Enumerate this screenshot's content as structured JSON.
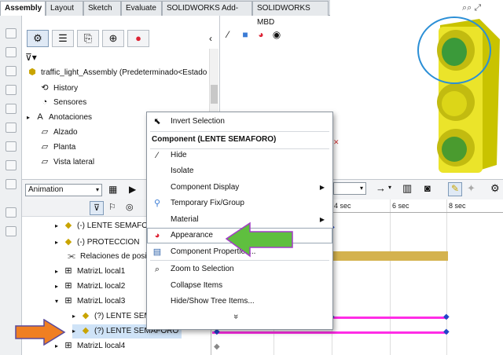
{
  "tabs": [
    "Assembly",
    "Layout",
    "Sketch",
    "Evaluate",
    "SOLIDWORKS Add-Ins",
    "SOLIDWORKS MBD"
  ],
  "active_tab": "Assembly",
  "feature_tree": {
    "root": "traffic_light_Assembly  (Predeterminado<Estado",
    "items": [
      "History",
      "Sensores",
      "Anotaciones",
      "Alzado",
      "Planta",
      "Vista lateral"
    ]
  },
  "motion": {
    "study_type": "Animation",
    "timeline_labels": [
      "4 sec",
      "6 sec",
      "8 sec"
    ],
    "tree": [
      "(-) LENTE SEMAFO",
      "(-) PROTECCION",
      "Relaciones de posi",
      "MatrizL local1",
      "MatrizL local2",
      "MatrizL local3",
      "(?) LENTE SEM",
      "(?) LENTE SEMAFORO",
      "MatrizL local4"
    ]
  },
  "context_menu": {
    "items": [
      {
        "label": "Invert Selection",
        "icon": "cursor-icon"
      },
      {
        "label": "Component (LENTE SEMAFORO)",
        "header": true
      },
      {
        "label": "Hide",
        "icon": "hide-icon"
      },
      {
        "label": "Isolate"
      },
      {
        "label": "Component Display",
        "submenu": true
      },
      {
        "label": "Temporary Fix/Group",
        "icon": "fix-icon"
      },
      {
        "label": "Material",
        "submenu": true
      },
      {
        "label": "Appearance",
        "icon": "appearance-icon",
        "highlighted": true
      },
      {
        "label": "Component Properties...",
        "icon": "properties-icon"
      },
      {
        "label": "Zoom to Selection",
        "icon": "zoom-icon"
      },
      {
        "label": "Collapse Items"
      },
      {
        "label": "Hide/Show Tree Items..."
      }
    ],
    "more": "»"
  },
  "colors": {
    "accent_green": "#5fbf3f",
    "accent_orange": "#f07f22",
    "key_magenta": "#ff2de6",
    "bar_tan": "#d4b24e",
    "traffic_yellow": "#f2ec2c"
  }
}
